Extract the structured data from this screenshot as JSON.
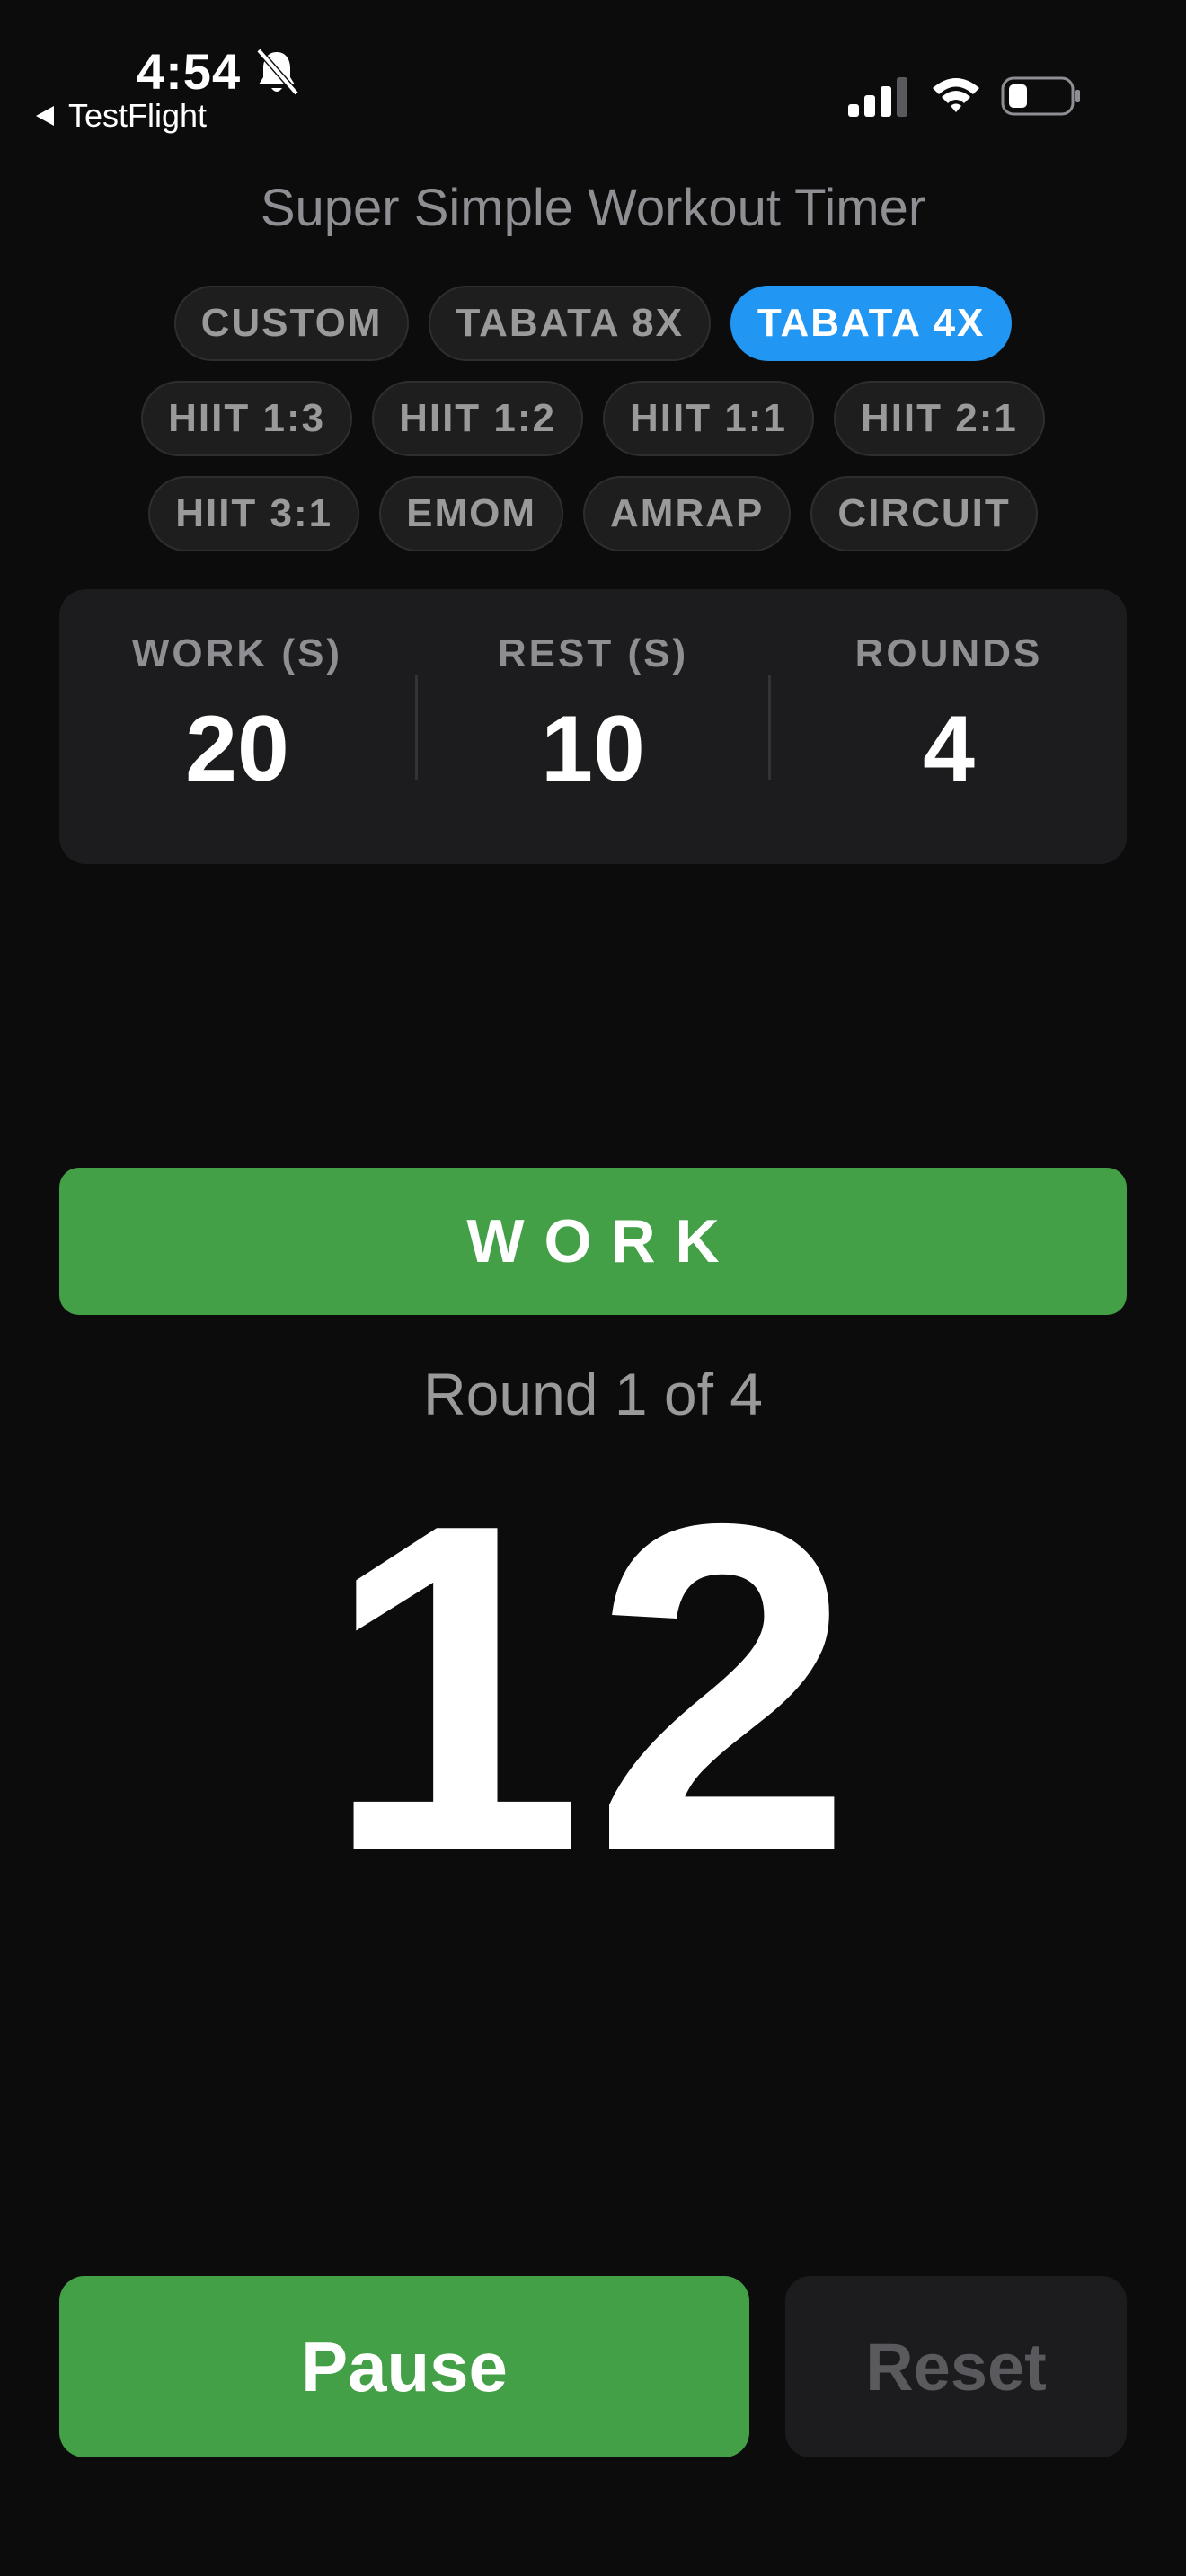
{
  "status_bar": {
    "time": "4:54",
    "back_label": "TestFlight"
  },
  "app": {
    "title": "Super Simple Workout Timer"
  },
  "presets": {
    "row1": [
      {
        "label": "CUSTOM",
        "active": false
      },
      {
        "label": "TABATA 8X",
        "active": false
      },
      {
        "label": "TABATA 4X",
        "active": true
      }
    ],
    "row2": [
      {
        "label": "HIIT 1:3",
        "active": false
      },
      {
        "label": "HIIT 1:2",
        "active": false
      },
      {
        "label": "HIIT 1:1",
        "active": false
      },
      {
        "label": "HIIT 2:1",
        "active": false
      }
    ],
    "row3": [
      {
        "label": "HIIT 3:1",
        "active": false
      },
      {
        "label": "EMOM",
        "active": false
      },
      {
        "label": "AMRAP",
        "active": false
      },
      {
        "label": "CIRCUIT",
        "active": false
      }
    ]
  },
  "settings": {
    "work": {
      "label": "WORK (S)",
      "value": "20"
    },
    "rest": {
      "label": "REST (S)",
      "value": "10"
    },
    "rounds": {
      "label": "ROUNDS",
      "value": "4"
    }
  },
  "timer": {
    "phase": "WORK",
    "round_text": "Round 1 of 4",
    "remaining": "12"
  },
  "controls": {
    "pause_label": "Pause",
    "reset_label": "Reset"
  },
  "colors": {
    "accent_blue": "#2196f3",
    "work_green": "#43a047",
    "background": "#0c0c0c",
    "panel": "#1c1c1e"
  }
}
